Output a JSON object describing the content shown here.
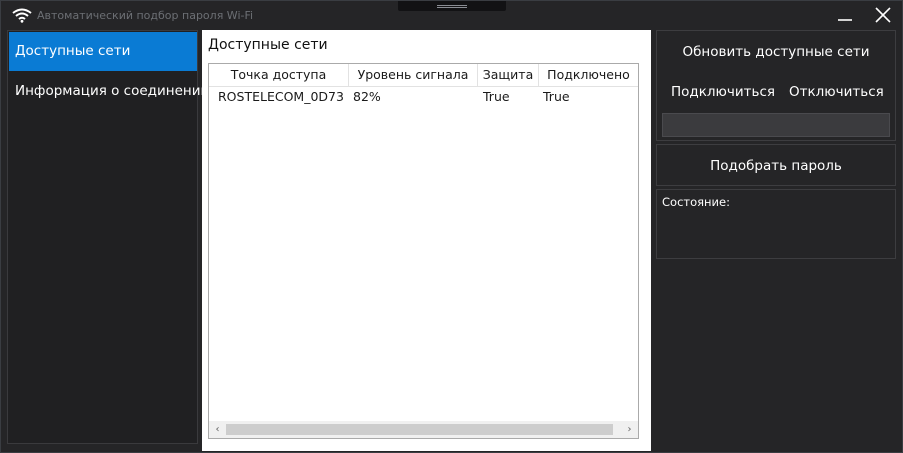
{
  "window": {
    "title": "Автоматический подбор пароля Wi-Fi"
  },
  "nav": {
    "items": [
      {
        "label": "Доступные сети"
      },
      {
        "label": "Информация о соединении"
      }
    ]
  },
  "networks": {
    "title": "Доступные сети",
    "columns": [
      "Точка доступа",
      "Уровень сигнала",
      "Защита",
      "Подключено"
    ],
    "rows": [
      [
        "ROSTELECOM_0D73",
        "82%",
        "True",
        "True"
      ]
    ]
  },
  "actions": {
    "refresh_label": "Обновить доступные сети",
    "connect_label": "Подключиться",
    "disconnect_label": "Отключиться",
    "password_value": "",
    "pick_password_label": "Подобрать пароль"
  },
  "status": {
    "label": "Состояние:"
  },
  "colors": {
    "accent": "#0a7bd4",
    "window_bg": "#252527",
    "panel_bg": "#ffffff"
  },
  "icons": {
    "app": "wifi-icon",
    "minimize": "minimize-icon",
    "close": "close-icon"
  }
}
